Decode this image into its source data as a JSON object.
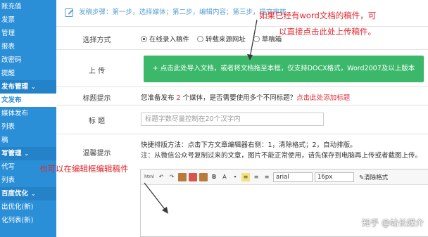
{
  "sidebar": {
    "items": [
      {
        "label": "账充值",
        "type": "item"
      },
      {
        "label": "发票",
        "type": "item"
      },
      {
        "label": "管理",
        "type": "item"
      },
      {
        "label": "报表",
        "type": "item"
      },
      {
        "label": "改密码",
        "type": "item"
      },
      {
        "label": "提醒",
        "type": "item"
      },
      {
        "label": "发布管理",
        "type": "group"
      },
      {
        "label": "文发布",
        "type": "active"
      },
      {
        "label": "媒体发布",
        "type": "item"
      },
      {
        "label": "列表",
        "type": "item"
      },
      {
        "label": "稿",
        "type": "item"
      },
      {
        "label": "写管理",
        "type": "group"
      },
      {
        "label": "代写",
        "type": "item"
      },
      {
        "label": "列表",
        "type": "item"
      },
      {
        "label": "百度优化",
        "type": "group"
      },
      {
        "label": "出优化(新)",
        "type": "item"
      },
      {
        "label": "化列表(新)",
        "type": "item"
      }
    ]
  },
  "steps": "发稿步骤：第一步，选择媒体；第二步，编辑内容；第三步，提交审核",
  "form": {
    "select_method": {
      "label": "选择方式",
      "options": [
        "在线录入稿件",
        "转载来源网址",
        "草稿箱"
      ]
    },
    "upload": {
      "label": "上 传",
      "button": "+ 点击此处导入文档，或者将文档拖至本框，仅支持DOCX格式，Word2007及以上版本"
    },
    "title_hint": {
      "label": "标题提示",
      "text_prefix": "您准备发布",
      "count": "2",
      "text_suffix": "个媒体，是否需要使用多个不同标题？",
      "link": "点击此处添加标题"
    },
    "title": {
      "label": "标 题",
      "placeholder": "标题字数尽量控制在20个汉字内"
    },
    "tips": {
      "label": "温馨提示",
      "line1": "快捷排版方法：点击下方文章编辑器右侧：1，清除格式；2，自动排版。",
      "line2": "注：从微信公众号复制过来的文章，图片不能正常使用，请先保存到电脑再上传或者截图上传。"
    }
  },
  "editor": {
    "font": "arial",
    "size": "16px",
    "clear_format": "清除格式"
  },
  "annotations": {
    "top_right_line1": "如果已经有word文档的稿件，可",
    "top_right_line2": "以直接点击此处上传稿件。",
    "left": "也可以在编辑框编辑稿件"
  },
  "watermark": "知乎 @站长媒介",
  "colors": {
    "sidebar": "#2b8fd8",
    "upload_button": "#3cb86a",
    "annotation": "#e3262d"
  }
}
